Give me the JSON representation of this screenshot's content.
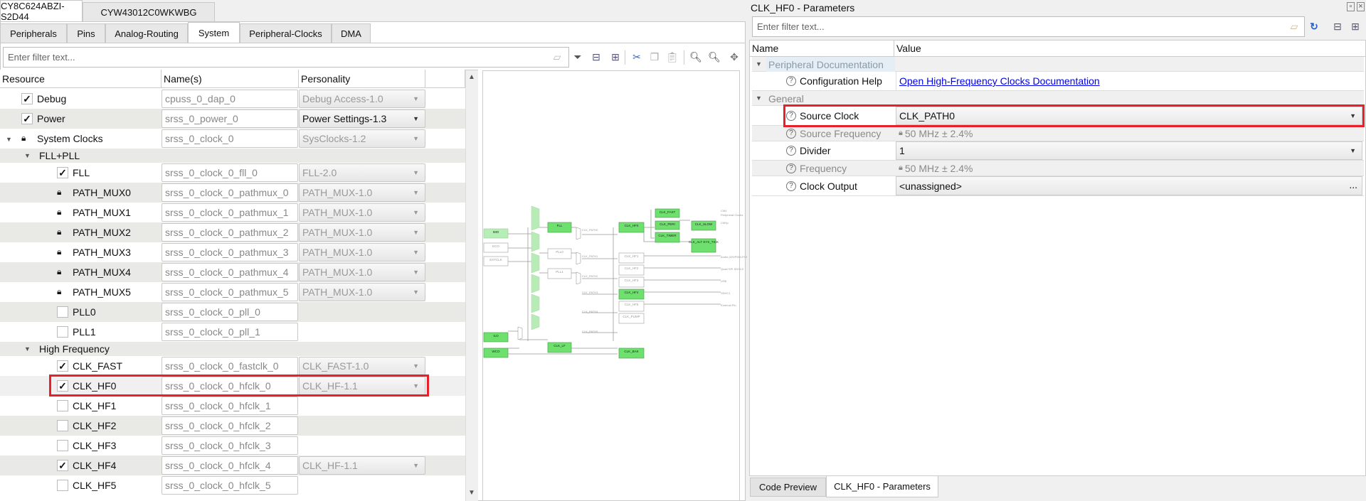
{
  "device_tabs": [
    "CY8C624ABZI-S2D44",
    "CYW43012C0WKWBG"
  ],
  "sub_tabs": [
    "Peripherals",
    "Pins",
    "Analog-Routing",
    "System",
    "Peripheral-Clocks",
    "DMA"
  ],
  "active_sub_tab": "System",
  "left_filter": {
    "placeholder": "Enter filter text..."
  },
  "toolbar_icons": [
    "eraser-icon",
    "filter-icon",
    "collapse-all-icon",
    "expand-all-icon",
    "cut-icon",
    "copy-icon",
    "paste-icon",
    "zoom-in-icon",
    "zoom-out-icon",
    "zoom-fit-icon"
  ],
  "tree": {
    "columns": [
      "Resource",
      "Name(s)",
      "Personality"
    ],
    "rows": [
      {
        "label": "Debug",
        "state": "checked",
        "name": "cpuss_0_dap_0",
        "personality": "Debug Access-1.0"
      },
      {
        "label": "Power",
        "state": "checked",
        "name": "srss_0_power_0",
        "personality": "Power Settings-1.3",
        "enabled": true
      },
      {
        "label": "System Clocks",
        "state": "locked",
        "name": "srss_0_clock_0",
        "personality": "SysClocks-1.2",
        "expand": true
      },
      {
        "label": "FLL+PLL",
        "group": true
      },
      {
        "label": "FLL",
        "state": "checked",
        "name": "srss_0_clock_0_fll_0",
        "personality": "FLL-2.0"
      },
      {
        "label": "PATH_MUX0",
        "state": "locked",
        "name": "srss_0_clock_0_pathmux_0",
        "personality": "PATH_MUX-1.0"
      },
      {
        "label": "PATH_MUX1",
        "state": "locked",
        "name": "srss_0_clock_0_pathmux_1",
        "personality": "PATH_MUX-1.0"
      },
      {
        "label": "PATH_MUX2",
        "state": "locked",
        "name": "srss_0_clock_0_pathmux_2",
        "personality": "PATH_MUX-1.0"
      },
      {
        "label": "PATH_MUX3",
        "state": "locked",
        "name": "srss_0_clock_0_pathmux_3",
        "personality": "PATH_MUX-1.0"
      },
      {
        "label": "PATH_MUX4",
        "state": "locked",
        "name": "srss_0_clock_0_pathmux_4",
        "personality": "PATH_MUX-1.0"
      },
      {
        "label": "PATH_MUX5",
        "state": "locked",
        "name": "srss_0_clock_0_pathmux_5",
        "personality": "PATH_MUX-1.0"
      },
      {
        "label": "PLL0",
        "state": "unchecked",
        "name": "srss_0_clock_0_pll_0"
      },
      {
        "label": "PLL1",
        "state": "unchecked",
        "name": "srss_0_clock_0_pll_1"
      },
      {
        "label": "High Frequency",
        "group": true
      },
      {
        "label": "CLK_FAST",
        "state": "checked",
        "name": "srss_0_clock_0_fastclk_0",
        "personality": "CLK_FAST-1.0"
      },
      {
        "label": "CLK_HF0",
        "state": "checked",
        "name": "srss_0_clock_0_hfclk_0",
        "personality": "CLK_HF-1.1",
        "selected": true
      },
      {
        "label": "CLK_HF1",
        "state": "unchecked",
        "name": "srss_0_clock_0_hfclk_1"
      },
      {
        "label": "CLK_HF2",
        "state": "unchecked",
        "name": "srss_0_clock_0_hfclk_2"
      },
      {
        "label": "CLK_HF3",
        "state": "unchecked",
        "name": "srss_0_clock_0_hfclk_3"
      },
      {
        "label": "CLK_HF4",
        "state": "checked",
        "name": "srss_0_clock_0_hfclk_4",
        "personality": "CLK_HF-1.1"
      },
      {
        "label": "CLK_HF5",
        "state": "unchecked",
        "name": "srss_0_clock_0_hfclk_5"
      }
    ]
  },
  "diagram": {
    "sources": [
      "IMO",
      "ECO",
      "EXTCLK",
      "ILO",
      "WCO"
    ],
    "plls": [
      "FLL",
      "PLL0",
      "PLL1"
    ],
    "paths": [
      "CLK_PATH0",
      "CLK_PATH1",
      "CLK_PATH2",
      "CLK_PATH3",
      "CLK_PATH4",
      "CLK_PATH5"
    ],
    "hf": [
      "CLK_HF0",
      "CLK_HF1",
      "CLK_HF2",
      "CLK_HF3",
      "CLK_HF4",
      "CLK_HF5",
      "CLK_PUMP"
    ],
    "others": [
      "CLK_LF",
      "CLK_BAK",
      "CLK_FAST",
      "CLK_PERI",
      "CLK_TIMER",
      "CLK_SLOW",
      "CLK_ALT SYS_TICK"
    ],
    "outputs": [
      "CM4",
      "Peripheral Clocks",
      "CM0p",
      "Audio (I2S/PDM-PCM)",
      "Quad SPI SDHC0",
      "USB",
      "SDHC1",
      "External Pin"
    ],
    "active_color": "#6ee06e",
    "inactive_color": "#ffffff"
  },
  "params": {
    "title": "CLK_HF0 - Parameters",
    "filter_placeholder": "Enter filter text...",
    "columns": [
      "Name",
      "Value"
    ],
    "groups": [
      "Peripheral Documentation",
      "General"
    ],
    "config_help": {
      "label": "Configuration Help",
      "value": "Open High-Frequency Clocks Documentation"
    },
    "source_clock": {
      "label": "Source Clock",
      "value": "CLK_PATH0"
    },
    "source_frequency": {
      "label": "Source Frequency",
      "value": "50 MHz ± 2.4%"
    },
    "divider": {
      "label": "Divider",
      "value": "1"
    },
    "frequency": {
      "label": "Frequency",
      "value": "50 MHz ± 2.4%"
    },
    "clock_output": {
      "label": "Clock Output",
      "value": "<unassigned>",
      "button": "..."
    }
  },
  "bottom_tabs": [
    "Code Preview",
    "CLK_HF0 - Parameters"
  ],
  "highlight_color": "#e8202a",
  "link_color": "#0000ee"
}
